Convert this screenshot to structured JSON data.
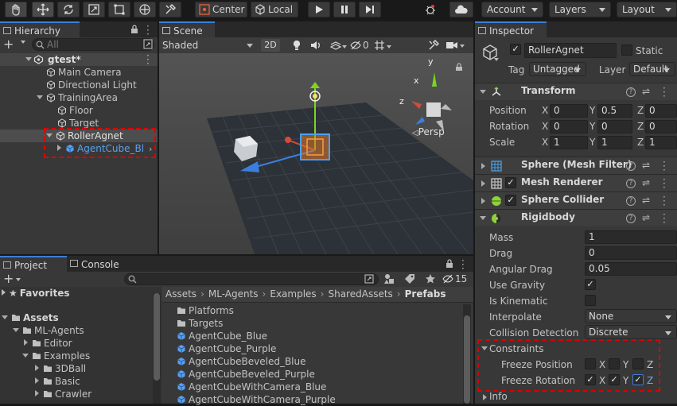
{
  "toolbar": {
    "pivot_label": "Center",
    "space_label": "Local",
    "account_label": "Account",
    "layers_label": "Layers",
    "layout_label": "Layout"
  },
  "hierarchy": {
    "tab_label": "Hierarchy",
    "add_label": "+",
    "search_placeholder": "All",
    "scene_name": "gtest*",
    "items": [
      {
        "label": "Main Camera"
      },
      {
        "label": "Directional Light"
      },
      {
        "label": "TrainingArea"
      },
      {
        "label": "Floor"
      },
      {
        "label": "Target"
      },
      {
        "label": "RollerAgnet"
      },
      {
        "label": "AgentCube_Bl"
      }
    ]
  },
  "scene": {
    "tab_label": "Scene",
    "shading_mode": "Shaded",
    "mode_2d": "2D",
    "hidden_count": "0",
    "persp_label": "Persp",
    "axis_x": "x",
    "axis_y": "y",
    "axis_z": "z"
  },
  "project": {
    "project_tab": "Project",
    "console_tab": "Console",
    "add_label": "+",
    "hidden_count": "15",
    "favorites_label": "Favorites",
    "assets_label": "Assets",
    "tree": [
      {
        "label": "ML-Agents"
      },
      {
        "label": "Editor"
      },
      {
        "label": "Examples"
      },
      {
        "label": "3DBall"
      },
      {
        "label": "Basic"
      },
      {
        "label": "Crawler"
      }
    ],
    "breadcrumb": [
      "Assets",
      "ML-Agents",
      "Examples",
      "SharedAssets",
      "Prefabs"
    ],
    "files": [
      {
        "label": "Platforms",
        "kind": "folder"
      },
      {
        "label": "Targets",
        "kind": "folder"
      },
      {
        "label": "AgentCube_Blue",
        "kind": "prefab"
      },
      {
        "label": "AgentCube_Purple",
        "kind": "prefab"
      },
      {
        "label": "AgentCubeBeveled_Blue",
        "kind": "prefab"
      },
      {
        "label": "AgentCubeBeveled_Purple",
        "kind": "prefab"
      },
      {
        "label": "AgentCubeWithCamera_Blue",
        "kind": "prefab"
      },
      {
        "label": "AgentCubeWithCamera_Purple",
        "kind": "prefab"
      }
    ]
  },
  "inspector": {
    "tab_label": "Inspector",
    "object_name": "RollerAgnet",
    "static_label": "Static",
    "tag_label": "Tag",
    "tag_value": "Untagged",
    "layer_label": "Layer",
    "layer_value": "Default",
    "transform": {
      "title": "Transform",
      "position_label": "Position",
      "rotation_label": "Rotation",
      "scale_label": "Scale",
      "axis_x": "X",
      "axis_y": "Y",
      "axis_z": "Z",
      "position": [
        "0",
        "0.5",
        "0"
      ],
      "rotation": [
        "0",
        "0",
        "0"
      ],
      "scale": [
        "1",
        "1",
        "1"
      ]
    },
    "components": [
      {
        "title": "Sphere (Mesh Filter)"
      },
      {
        "title": "Mesh Renderer"
      },
      {
        "title": "Sphere Collider"
      },
      {
        "title": "Rigidbody"
      }
    ],
    "rigidbody": {
      "mass_label": "Mass",
      "mass": "1",
      "drag_label": "Drag",
      "drag": "0",
      "angular_drag_label": "Angular Drag",
      "angular_drag": "0.05",
      "use_gravity_label": "Use Gravity",
      "is_kinematic_label": "Is Kinematic",
      "interpolate_label": "Interpolate",
      "interpolate": "None",
      "collision_label": "Collision Detection",
      "collision": "Discrete",
      "constraints_label": "Constraints",
      "freeze_position_label": "Freeze Position",
      "freeze_rotation_label": "Freeze Rotation",
      "x": "X",
      "y": "Y",
      "z": "Z",
      "info_label": "Info"
    }
  }
}
